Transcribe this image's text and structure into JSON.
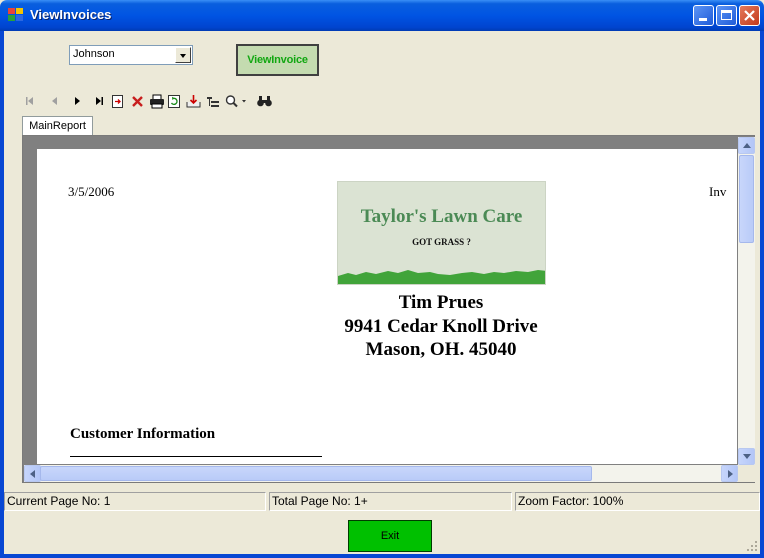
{
  "window": {
    "title": "ViewInvoices"
  },
  "form": {
    "customer_select_value": "Johnson",
    "view_invoice_label": "ViewInvoice",
    "exit_label": "Exit"
  },
  "toolbar": {
    "icons": [
      "first-page-icon",
      "prev-page-icon",
      "next-page-icon",
      "last-page-icon",
      "goto-page-icon",
      "close-view-icon",
      "print-icon",
      "refresh-icon",
      "export-icon",
      "group-tree-icon",
      "zoom-icon",
      "search-icon"
    ]
  },
  "tabs": [
    {
      "label": "MainReport"
    }
  ],
  "report": {
    "date": "3/5/2006",
    "header_right": "Inv",
    "logo": {
      "name": "Taylor's Lawn Care",
      "tagline": "GOT GRASS ?"
    },
    "company_lines": [
      "Tim Prues",
      "9941 Cedar Knoll Drive",
      "Mason, OH. 45040"
    ],
    "section_title": "Customer Information"
  },
  "status": {
    "current_page": "Current Page No: 1",
    "total_page": "Total Page No: 1+",
    "zoom": "Zoom Factor: 100%"
  },
  "colors": {
    "titlebar": "#0054e3",
    "view_invoice_bg": "#c4dbb0",
    "view_invoice_text": "#11a711",
    "exit_bg": "#00c000",
    "logo_text": "#4b8a55"
  }
}
